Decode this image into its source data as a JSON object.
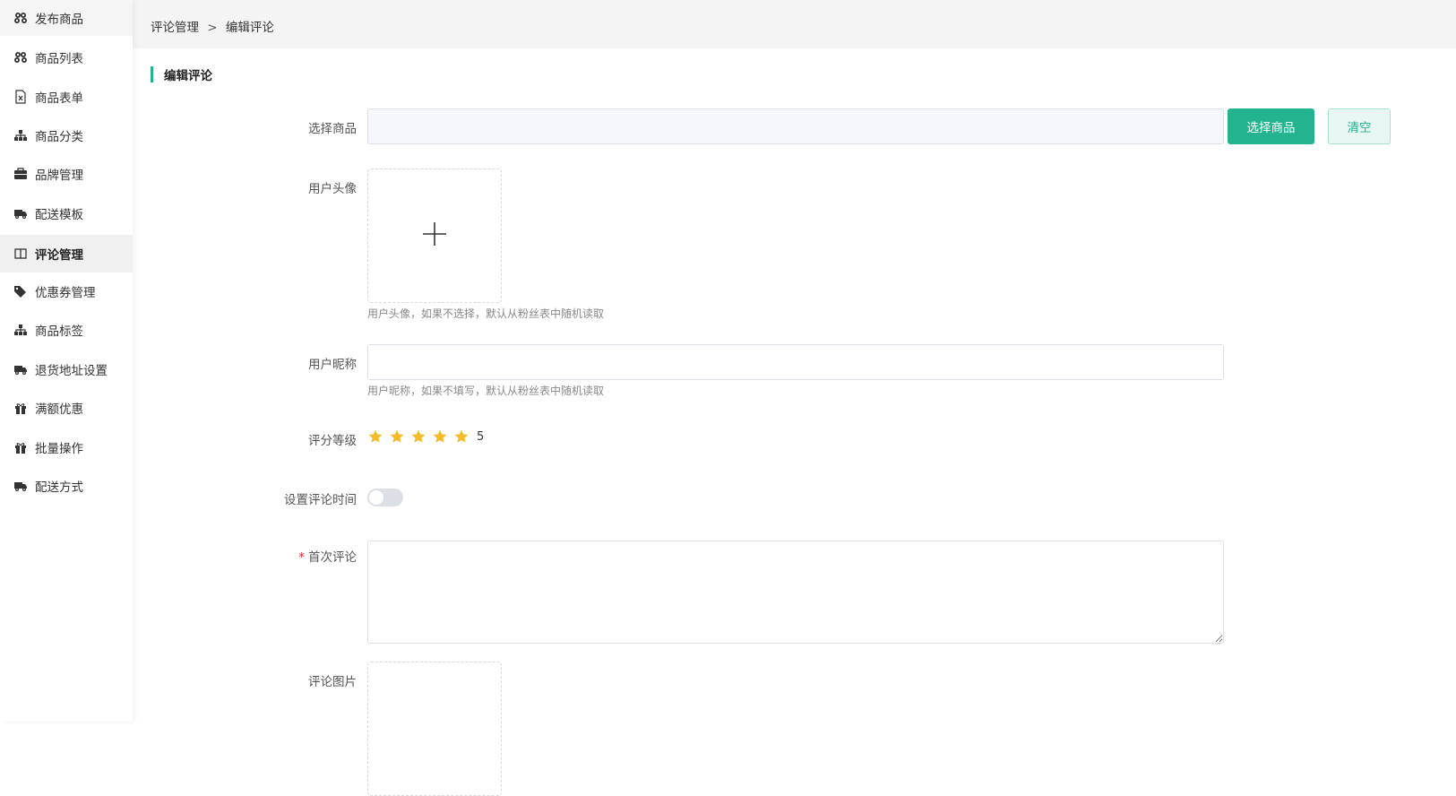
{
  "sidebar": {
    "items": [
      {
        "label": "发布商品",
        "icon": "cubes-icon"
      },
      {
        "label": "商品列表",
        "icon": "cubes-icon"
      },
      {
        "label": "商品表单",
        "icon": "excel-file-icon"
      },
      {
        "label": "商品分类",
        "icon": "sitemap-icon"
      },
      {
        "label": "品牌管理",
        "icon": "briefcase-icon"
      },
      {
        "label": "配送模板",
        "icon": "truck-icon"
      },
      {
        "label": "评论管理",
        "icon": "columns-icon",
        "active": true
      },
      {
        "label": "优惠券管理",
        "icon": "tags-icon"
      },
      {
        "label": "商品标签",
        "icon": "sitemap-icon"
      },
      {
        "label": "退货地址设置",
        "icon": "truck-icon"
      },
      {
        "label": "满额优惠",
        "icon": "gift-icon"
      },
      {
        "label": "批量操作",
        "icon": "gift-icon"
      },
      {
        "label": "配送方式",
        "icon": "truck-icon"
      }
    ]
  },
  "breadcrumb": {
    "parent": "评论管理",
    "separator": ">",
    "current": "编辑评论"
  },
  "section": {
    "title": "编辑评论"
  },
  "form": {
    "product": {
      "label": "选择商品",
      "value": "",
      "select_button": "选择商品",
      "clear_button": "清空"
    },
    "avatar": {
      "label": "用户头像",
      "hint": "用户头像，如果不选择，默认从粉丝表中随机读取"
    },
    "nickname": {
      "label": "用户昵称",
      "value": "",
      "hint": "用户昵称，如果不填写，默认从粉丝表中随机读取"
    },
    "rating": {
      "label": "评分等级",
      "stars": 5,
      "value": "5"
    },
    "set_time": {
      "label": "设置评论时间",
      "enabled": false
    },
    "first_comment": {
      "label": "首次评论",
      "required_mark": "*",
      "value": ""
    },
    "images": {
      "label": "评论图片"
    }
  },
  "colors": {
    "accent": "#23b38f",
    "star": "#f7ba2a",
    "required": "#f5222d"
  }
}
